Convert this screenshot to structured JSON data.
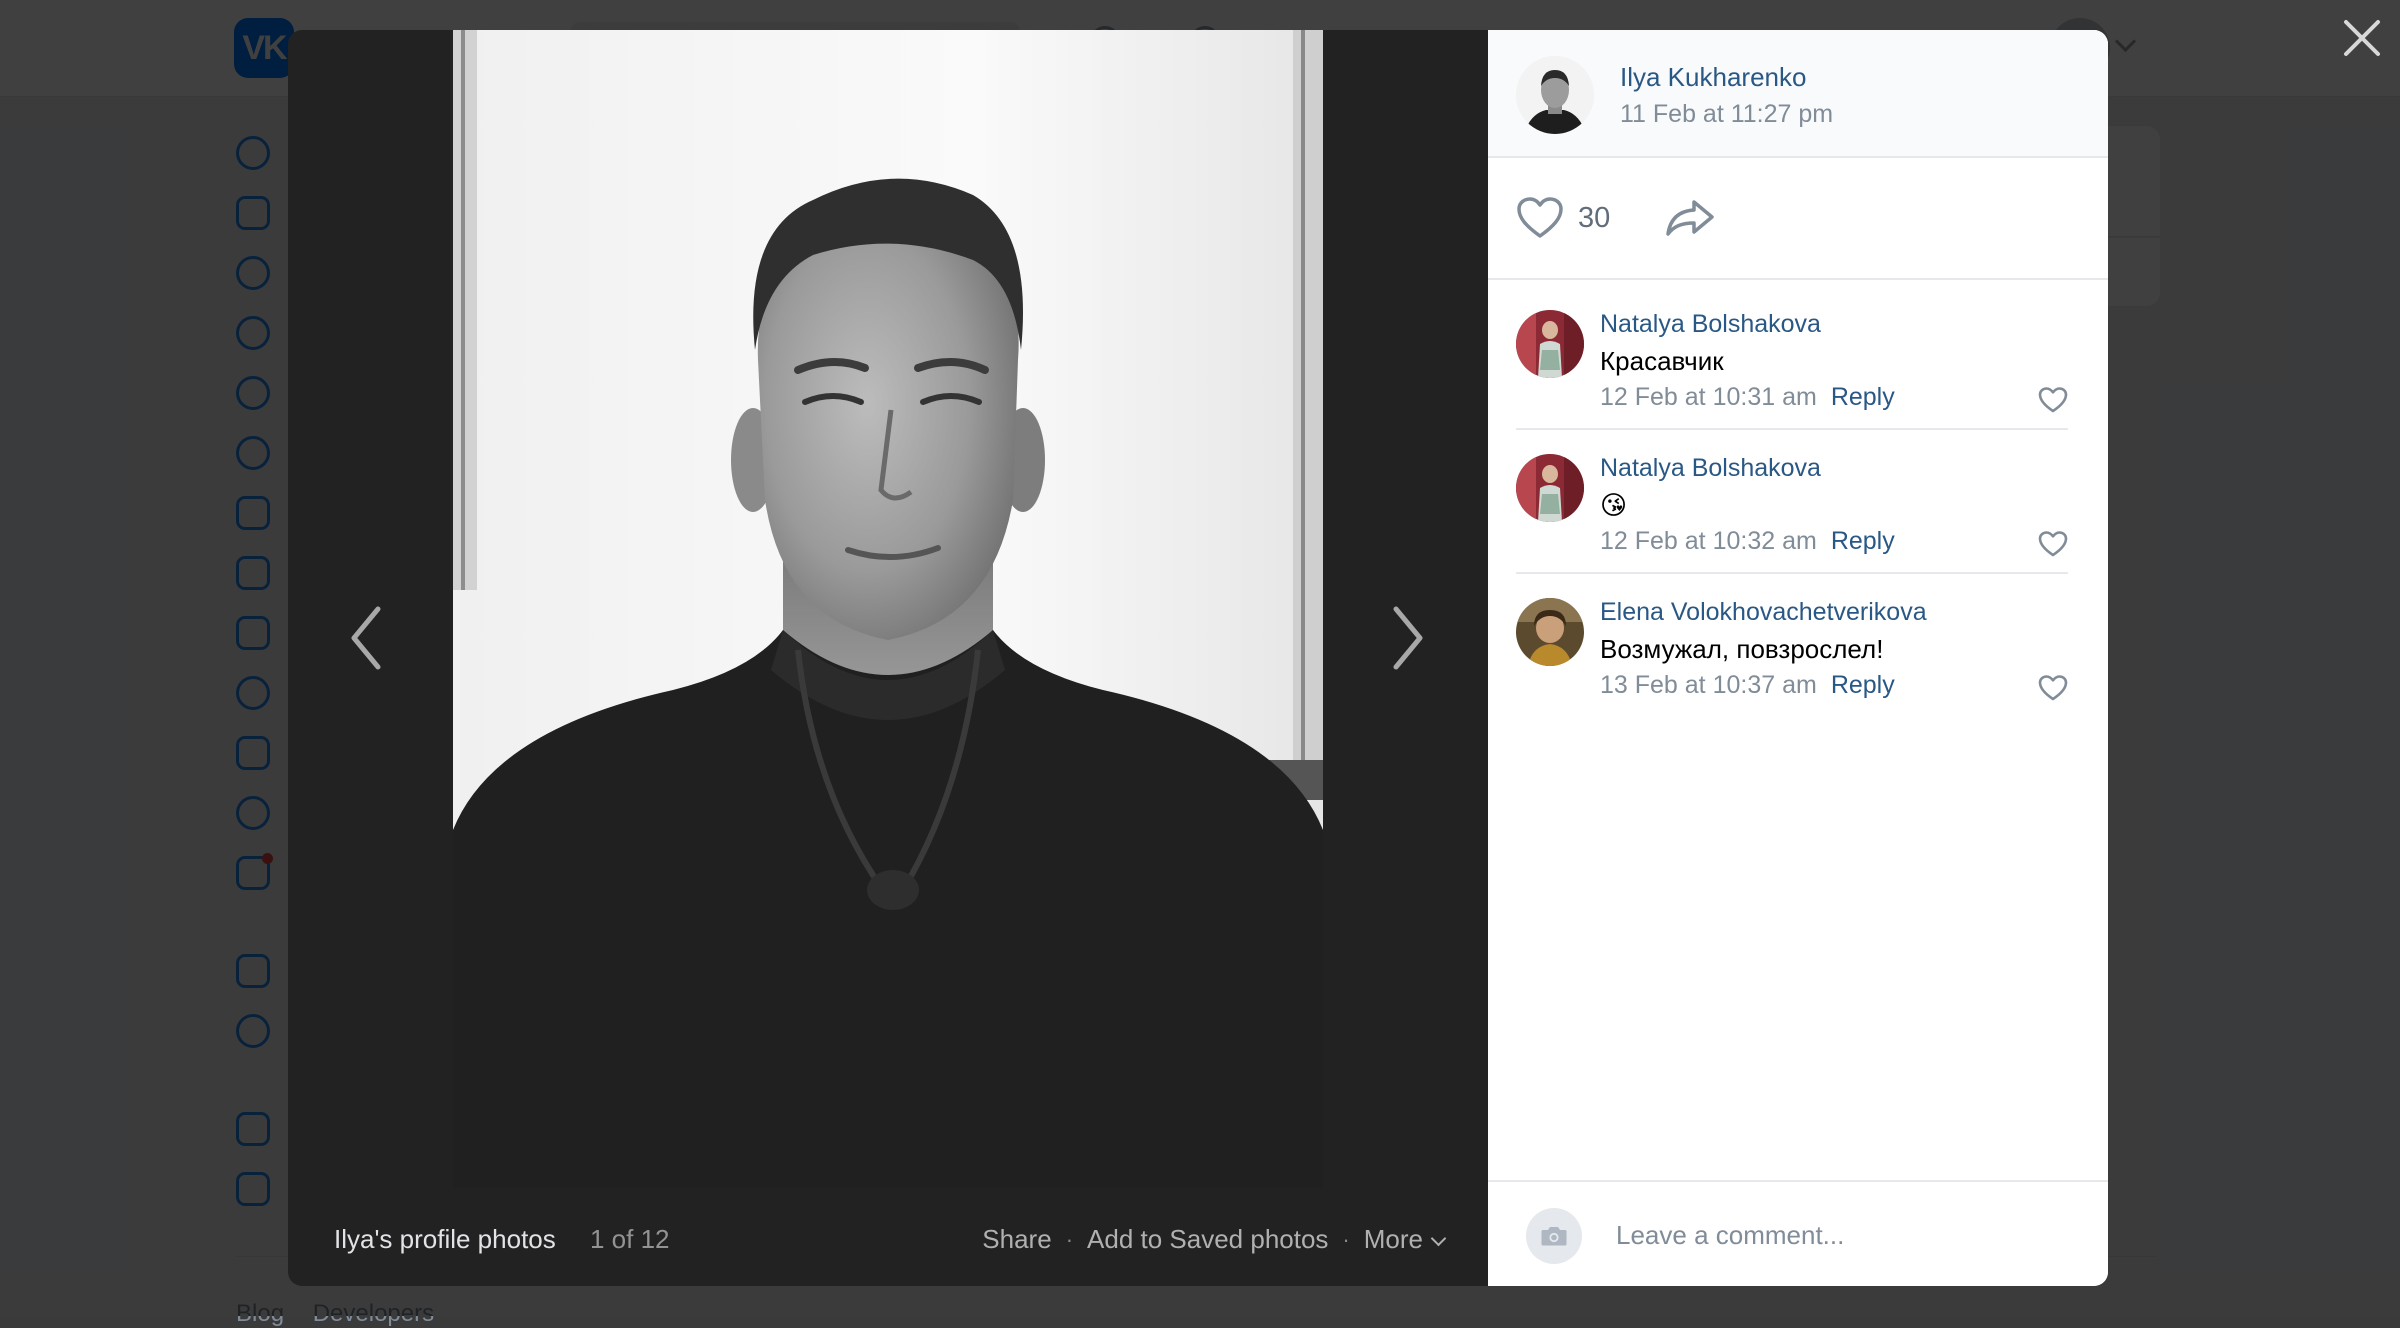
{
  "background": {
    "brand_logo": "VK",
    "footer_links": [
      "Blog",
      "Developers"
    ],
    "nav_icons": [
      "profile-icon",
      "news-icon",
      "messenger-icon",
      "calls-icon",
      "friends-icon",
      "communities-icon",
      "photos-icon",
      "music-icon",
      "video-icon",
      "clips-icon",
      "games-icon",
      "stickers-icon",
      "gifts-icon",
      "services-icon",
      "vk-pay-icon",
      "bookmarks-icon",
      "ads-icon"
    ]
  },
  "viewer": {
    "album_title": "Ilya's profile photos",
    "counter": "1 of 12",
    "actions": {
      "share": "Share",
      "save": "Add to Saved photos",
      "more": "More"
    }
  },
  "post": {
    "author_name": "Ilya Kukharenko",
    "date": "11 Feb at 11:27 pm",
    "likes_count": "30"
  },
  "comments": [
    {
      "author": "Natalya Bolshakova",
      "text": "Красавчик",
      "date": "12 Feb at 10:31 am",
      "reply_label": "Reply"
    },
    {
      "author": "Natalya Bolshakova",
      "text": "😘",
      "date": "12 Feb at 10:32 am",
      "reply_label": "Reply"
    },
    {
      "author": "Elena Volokhovachetverikova",
      "text": "Возмужал, повзрослел!",
      "date": "13 Feb at 10:37 am",
      "reply_label": "Reply"
    }
  ],
  "composer": {
    "placeholder": "Leave a comment..."
  },
  "colors": {
    "link": "#2a5885",
    "muted": "#818c99",
    "viewer_bg": "#222222",
    "accent": "#2688eb"
  }
}
